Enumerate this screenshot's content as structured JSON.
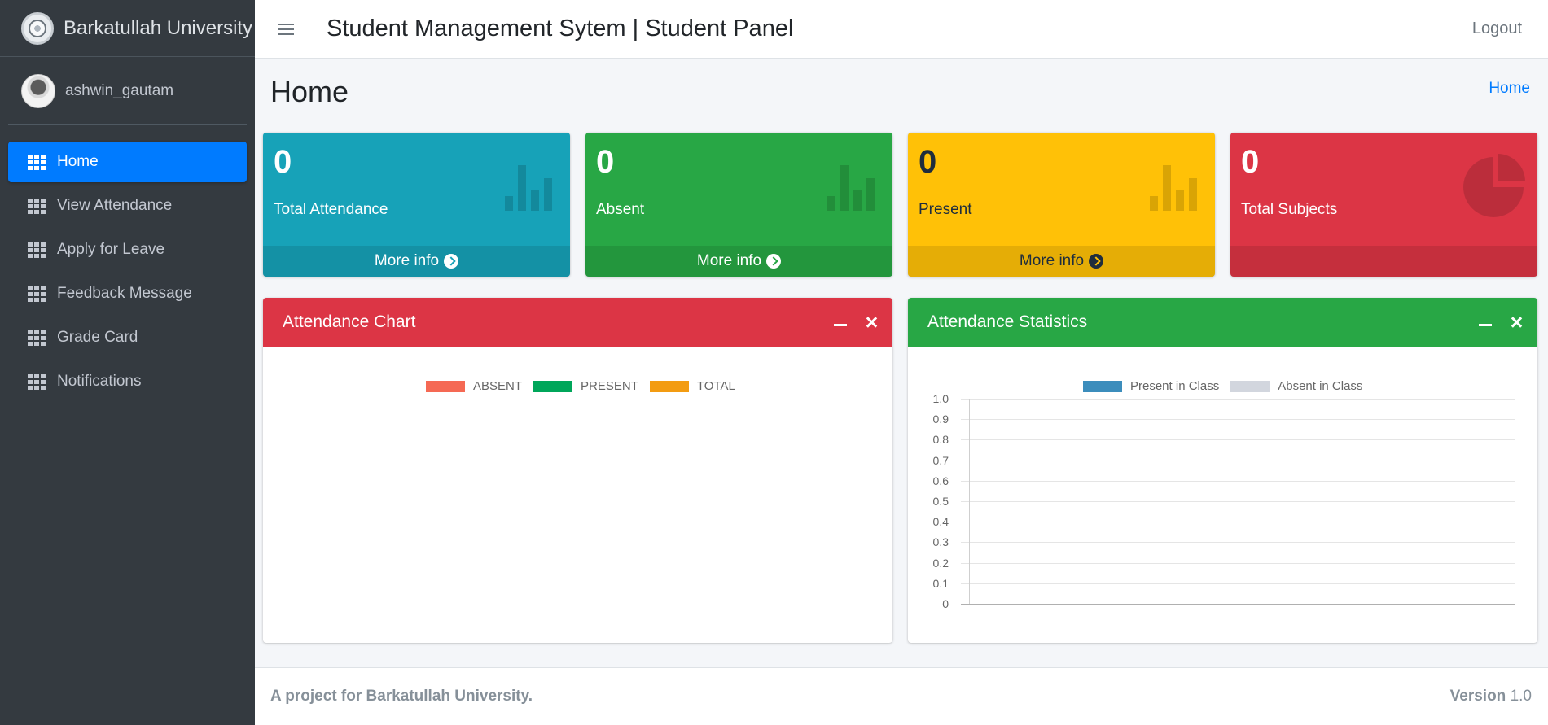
{
  "brand": {
    "name": "Barkatullah University",
    "logo_icon": "university-seal-icon"
  },
  "user": {
    "name": "ashwin_gautam"
  },
  "sidebar": {
    "items": [
      {
        "label": "Home",
        "icon": "grid-icon",
        "active": true
      },
      {
        "label": "View Attendance",
        "icon": "grid-icon"
      },
      {
        "label": "Apply for Leave",
        "icon": "grid-icon"
      },
      {
        "label": "Feedback Message",
        "icon": "grid-icon"
      },
      {
        "label": "Grade Card",
        "icon": "grid-icon"
      },
      {
        "label": "Notifications",
        "icon": "grid-icon"
      }
    ]
  },
  "topbar": {
    "title": "Student Management Sytem | Student Panel",
    "logout": "Logout"
  },
  "content": {
    "title": "Home",
    "breadcrumb": "Home"
  },
  "stats": [
    {
      "value": "0",
      "label": "Total Attendance",
      "footer": "More info",
      "color": "#17a2b8",
      "icon": "bar-chart-icon"
    },
    {
      "value": "0",
      "label": "Absent",
      "footer": "More info",
      "color": "#28a745",
      "icon": "bar-chart-icon"
    },
    {
      "value": "0",
      "label": "Present",
      "footer": "More info",
      "color": "#ffc107",
      "icon": "bar-chart-icon"
    },
    {
      "value": "0",
      "label": "Total Subjects",
      "footer": "",
      "color": "#dc3545",
      "icon": "pie-chart-icon"
    }
  ],
  "cards": {
    "attendance_chart": {
      "title": "Attendance Chart",
      "color": "#dc3545"
    },
    "attendance_statistics": {
      "title": "Attendance Statistics",
      "color": "#28a745"
    }
  },
  "chart_data": [
    {
      "type": "bar",
      "title": "",
      "legend_placement": "top-center",
      "series": [
        {
          "name": "ABSENT",
          "color": "#f56954",
          "values": []
        },
        {
          "name": "PRESENT",
          "color": "#00a65a",
          "values": []
        },
        {
          "name": "TOTAL",
          "color": "#f39c12",
          "values": []
        }
      ],
      "categories": []
    },
    {
      "type": "bar",
      "title": "",
      "legend_placement": "top-center",
      "grid": true,
      "ylim": [
        0,
        1.0
      ],
      "yticks": [
        "1.0",
        "0.9",
        "0.8",
        "0.7",
        "0.6",
        "0.5",
        "0.4",
        "0.3",
        "0.2",
        "0.1",
        "0"
      ],
      "series": [
        {
          "name": "Present in Class",
          "color": "#3c8dbc",
          "values": []
        },
        {
          "name": "Absent in Class",
          "color": "#d2d6de",
          "values": []
        }
      ],
      "categories": []
    }
  ],
  "footer": {
    "text": "A project for Barkatullah University.",
    "version_label": "Version",
    "version": "1.0"
  }
}
